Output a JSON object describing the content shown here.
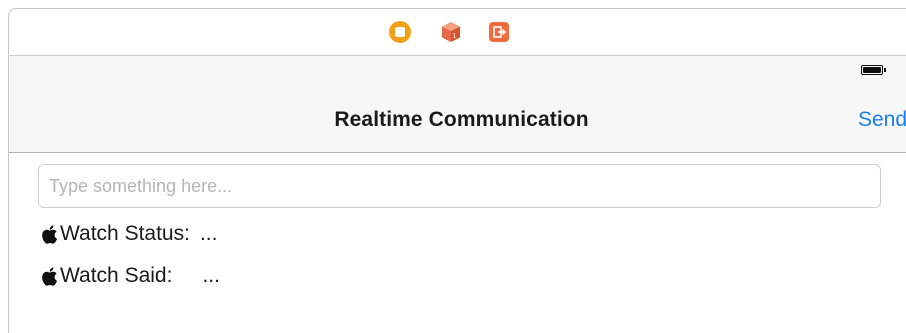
{
  "dock": {
    "icons": [
      "view-controller-icon",
      "first-responder-icon",
      "exit-icon"
    ],
    "colors": {
      "view_controller": "#f2a114",
      "first_responder": "#e8694a",
      "exit": "#f26b3c"
    }
  },
  "navbar": {
    "title": "Realtime Communication",
    "send_label": "Send",
    "accent_color": "#1a7ef2"
  },
  "message_field": {
    "placeholder": "Type something here...",
    "value": ""
  },
  "watch_status": {
    "label": "Watch Status:",
    "value": "..."
  },
  "watch_said": {
    "label": "Watch Said:",
    "value": "..."
  }
}
